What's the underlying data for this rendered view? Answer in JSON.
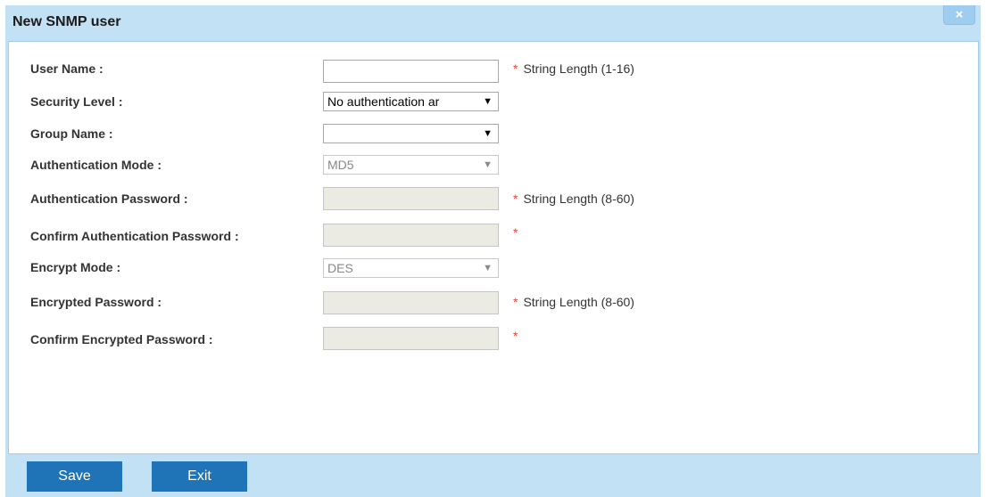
{
  "dialog": {
    "title": "New SNMP user",
    "close_label": "×"
  },
  "form": {
    "user_name": {
      "label": "User Name :",
      "value": "",
      "hint": "String Length (1-16)",
      "required": "*"
    },
    "security_level": {
      "label": "Security Level :",
      "value": "No authentication ar"
    },
    "group_name": {
      "label": "Group Name :",
      "value": ""
    },
    "auth_mode": {
      "label": "Authentication Mode :",
      "value": "MD5"
    },
    "auth_password": {
      "label": "Authentication Password :",
      "value": "",
      "hint": "String Length (8-60)",
      "required": "*"
    },
    "confirm_auth_password": {
      "label": "Confirm Authentication Password :",
      "value": "",
      "required": "*"
    },
    "encrypt_mode": {
      "label": "Encrypt Mode :",
      "value": "DES"
    },
    "encrypted_password": {
      "label": "Encrypted Password :",
      "value": "",
      "hint": "String Length (8-60)",
      "required": "*"
    },
    "confirm_encrypted_password": {
      "label": "Confirm Encrypted Password :",
      "value": "",
      "required": "*"
    }
  },
  "footer": {
    "save_label": "Save",
    "exit_label": "Exit"
  },
  "icons": {
    "dropdown": "chevron-down-icon",
    "close": "close-icon"
  },
  "colors": {
    "titlebar": "#c3e1f5",
    "button": "#1f73b7",
    "required_star": "#e3453a",
    "disabled_field": "#ebebe4"
  }
}
